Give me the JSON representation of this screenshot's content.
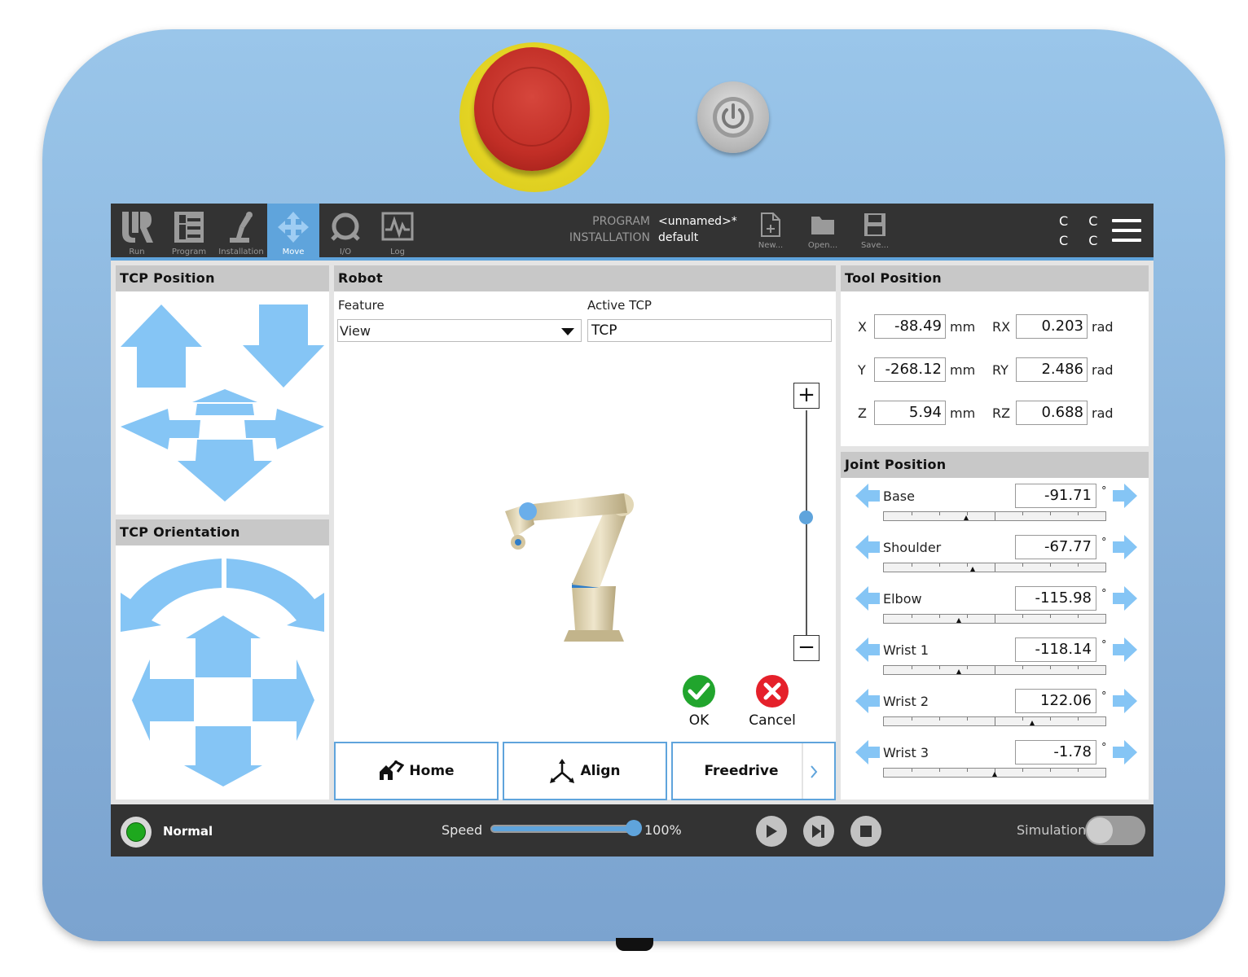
{
  "nav": {
    "tabs": [
      {
        "label": "Run"
      },
      {
        "label": "Program"
      },
      {
        "label": "Installation"
      },
      {
        "label": "Move"
      },
      {
        "label": "I/O"
      },
      {
        "label": "Log"
      }
    ],
    "active_tab": "Move"
  },
  "header": {
    "program_label": "PROGRAM",
    "program_value": "<unnamed>*",
    "installation_label": "INSTALLATION",
    "installation_value": "default",
    "file_buttons": [
      {
        "label": "New..."
      },
      {
        "label": "Open..."
      },
      {
        "label": "Save..."
      }
    ],
    "cc_glyphs": [
      "C C",
      "C C"
    ]
  },
  "tcp_position": {
    "title": "TCP Position"
  },
  "tcp_orientation": {
    "title": "TCP Orientation"
  },
  "robot": {
    "title": "Robot",
    "feature_label": "Feature",
    "feature_value": "View",
    "active_tcp_label": "Active TCP",
    "active_tcp_value": "TCP",
    "ok_label": "OK",
    "cancel_label": "Cancel",
    "home_label": "Home",
    "align_label": "Align",
    "freedrive_label": "Freedrive",
    "zoom_in": "+",
    "zoom_out": "−"
  },
  "tool_position": {
    "title": "Tool Position",
    "rows": [
      {
        "axis": "X",
        "value": "-88.49",
        "unit": "mm",
        "raxis": "RX",
        "rvalue": "0.203",
        "runit": "rad"
      },
      {
        "axis": "Y",
        "value": "-268.12",
        "unit": "mm",
        "raxis": "RY",
        "rvalue": "2.486",
        "runit": "rad"
      },
      {
        "axis": "Z",
        "value": "5.94",
        "unit": "mm",
        "raxis": "RZ",
        "rvalue": "0.688",
        "runit": "rad"
      }
    ]
  },
  "joint_position": {
    "title": "Joint Position",
    "degree_symbol": "°",
    "joints": [
      {
        "name": "Base",
        "value": "-91.71"
      },
      {
        "name": "Shoulder",
        "value": "-67.77"
      },
      {
        "name": "Elbow",
        "value": "-115.98"
      },
      {
        "name": "Wrist 1",
        "value": "-118.14"
      },
      {
        "name": "Wrist 2",
        "value": "122.06"
      },
      {
        "name": "Wrist 3",
        "value": "-1.78"
      }
    ]
  },
  "footer": {
    "status_label": "Normal",
    "speed_label": "Speed",
    "speed_value": "100%",
    "simulation_label": "Simulation"
  },
  "colors": {
    "accent": "#5fa4dc",
    "topbar": "#333333",
    "arrow": "#85c5f5",
    "status_ok": "#1ea81e"
  }
}
